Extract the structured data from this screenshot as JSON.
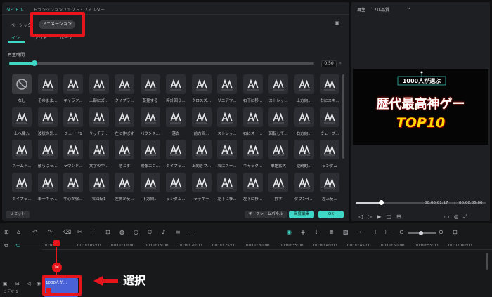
{
  "tabs": [
    "タイトル",
    "トランジション",
    "エフェクト・フィルター"
  ],
  "subtabs": [
    "ベーシック",
    "アニメーション"
  ],
  "subtabs2": [
    "イン",
    "アウト",
    "ループ"
  ],
  "duration_label": "再生時間",
  "duration_value": "0.50",
  "duration_unit": "s",
  "animations": [
    "なし",
    "そのまま...",
    "キャラク...",
    "上部にズ...",
    "タイプラ...",
    "蒸発する",
    "時計回り...",
    "クロスズ...",
    "リニアワ...",
    "右下に移...",
    "ストレッ...",
    "上方向...",
    "右にスキ...",
    "上へ挿入",
    "波状の外...",
    "フェード1",
    "リッチテ...",
    "左に伸ばす",
    "バウンス...",
    "落去",
    "前方回...",
    "ストレッ...",
    "右にズー...",
    "回転して...",
    "右方向...",
    "ウェーブ...",
    "ズームア...",
    "散らばっ...",
    "ラウンド...",
    "文字の中...",
    "落とす",
    "映像エフ...",
    "タイプラ...",
    "上向きフ...",
    "右にズー...",
    "キャラク...",
    "単語拡大",
    "逆説的...",
    "ランダム",
    "タイプラ...",
    "単一キャ...",
    "中心が徐...",
    "右回転1",
    "左側が反...",
    "下方向...",
    "ランダム...",
    "ラッキー",
    "左下に移...",
    "左下に移...",
    "押す",
    "ダウンイ...",
    "左上反..."
  ],
  "buttons": {
    "reset": "リセット",
    "keyframe": "キーフレームパネル",
    "advanced": "高度編集",
    "ok": "OK"
  },
  "preview": {
    "label": "再生",
    "quality": "フル品質",
    "line1": "1000人が選ぶ",
    "line2": "歴代最高神ゲー",
    "line3": "TOP10",
    "time_current": "00:00:01:17",
    "time_total": "00:00:05:00"
  },
  "ruler": [
    "00:00",
    "00:00:05:00",
    "00:00:10:00",
    "00:00:15:00",
    "00:00:20:00",
    "00:00:25:00",
    "00:00:30:00",
    "00:00:35:00",
    "00:00:40:00",
    "00:00:45:00",
    "00:00:50:00",
    "00:00:55:00",
    "00:01:00:00"
  ],
  "track": {
    "clip_label": "1000人が...",
    "track_name": "ビデオ 1"
  },
  "annotation": "選択",
  "colors": {
    "accent": "#3fd7c6",
    "red": "#e8141c",
    "clip": "#4a62d8"
  }
}
